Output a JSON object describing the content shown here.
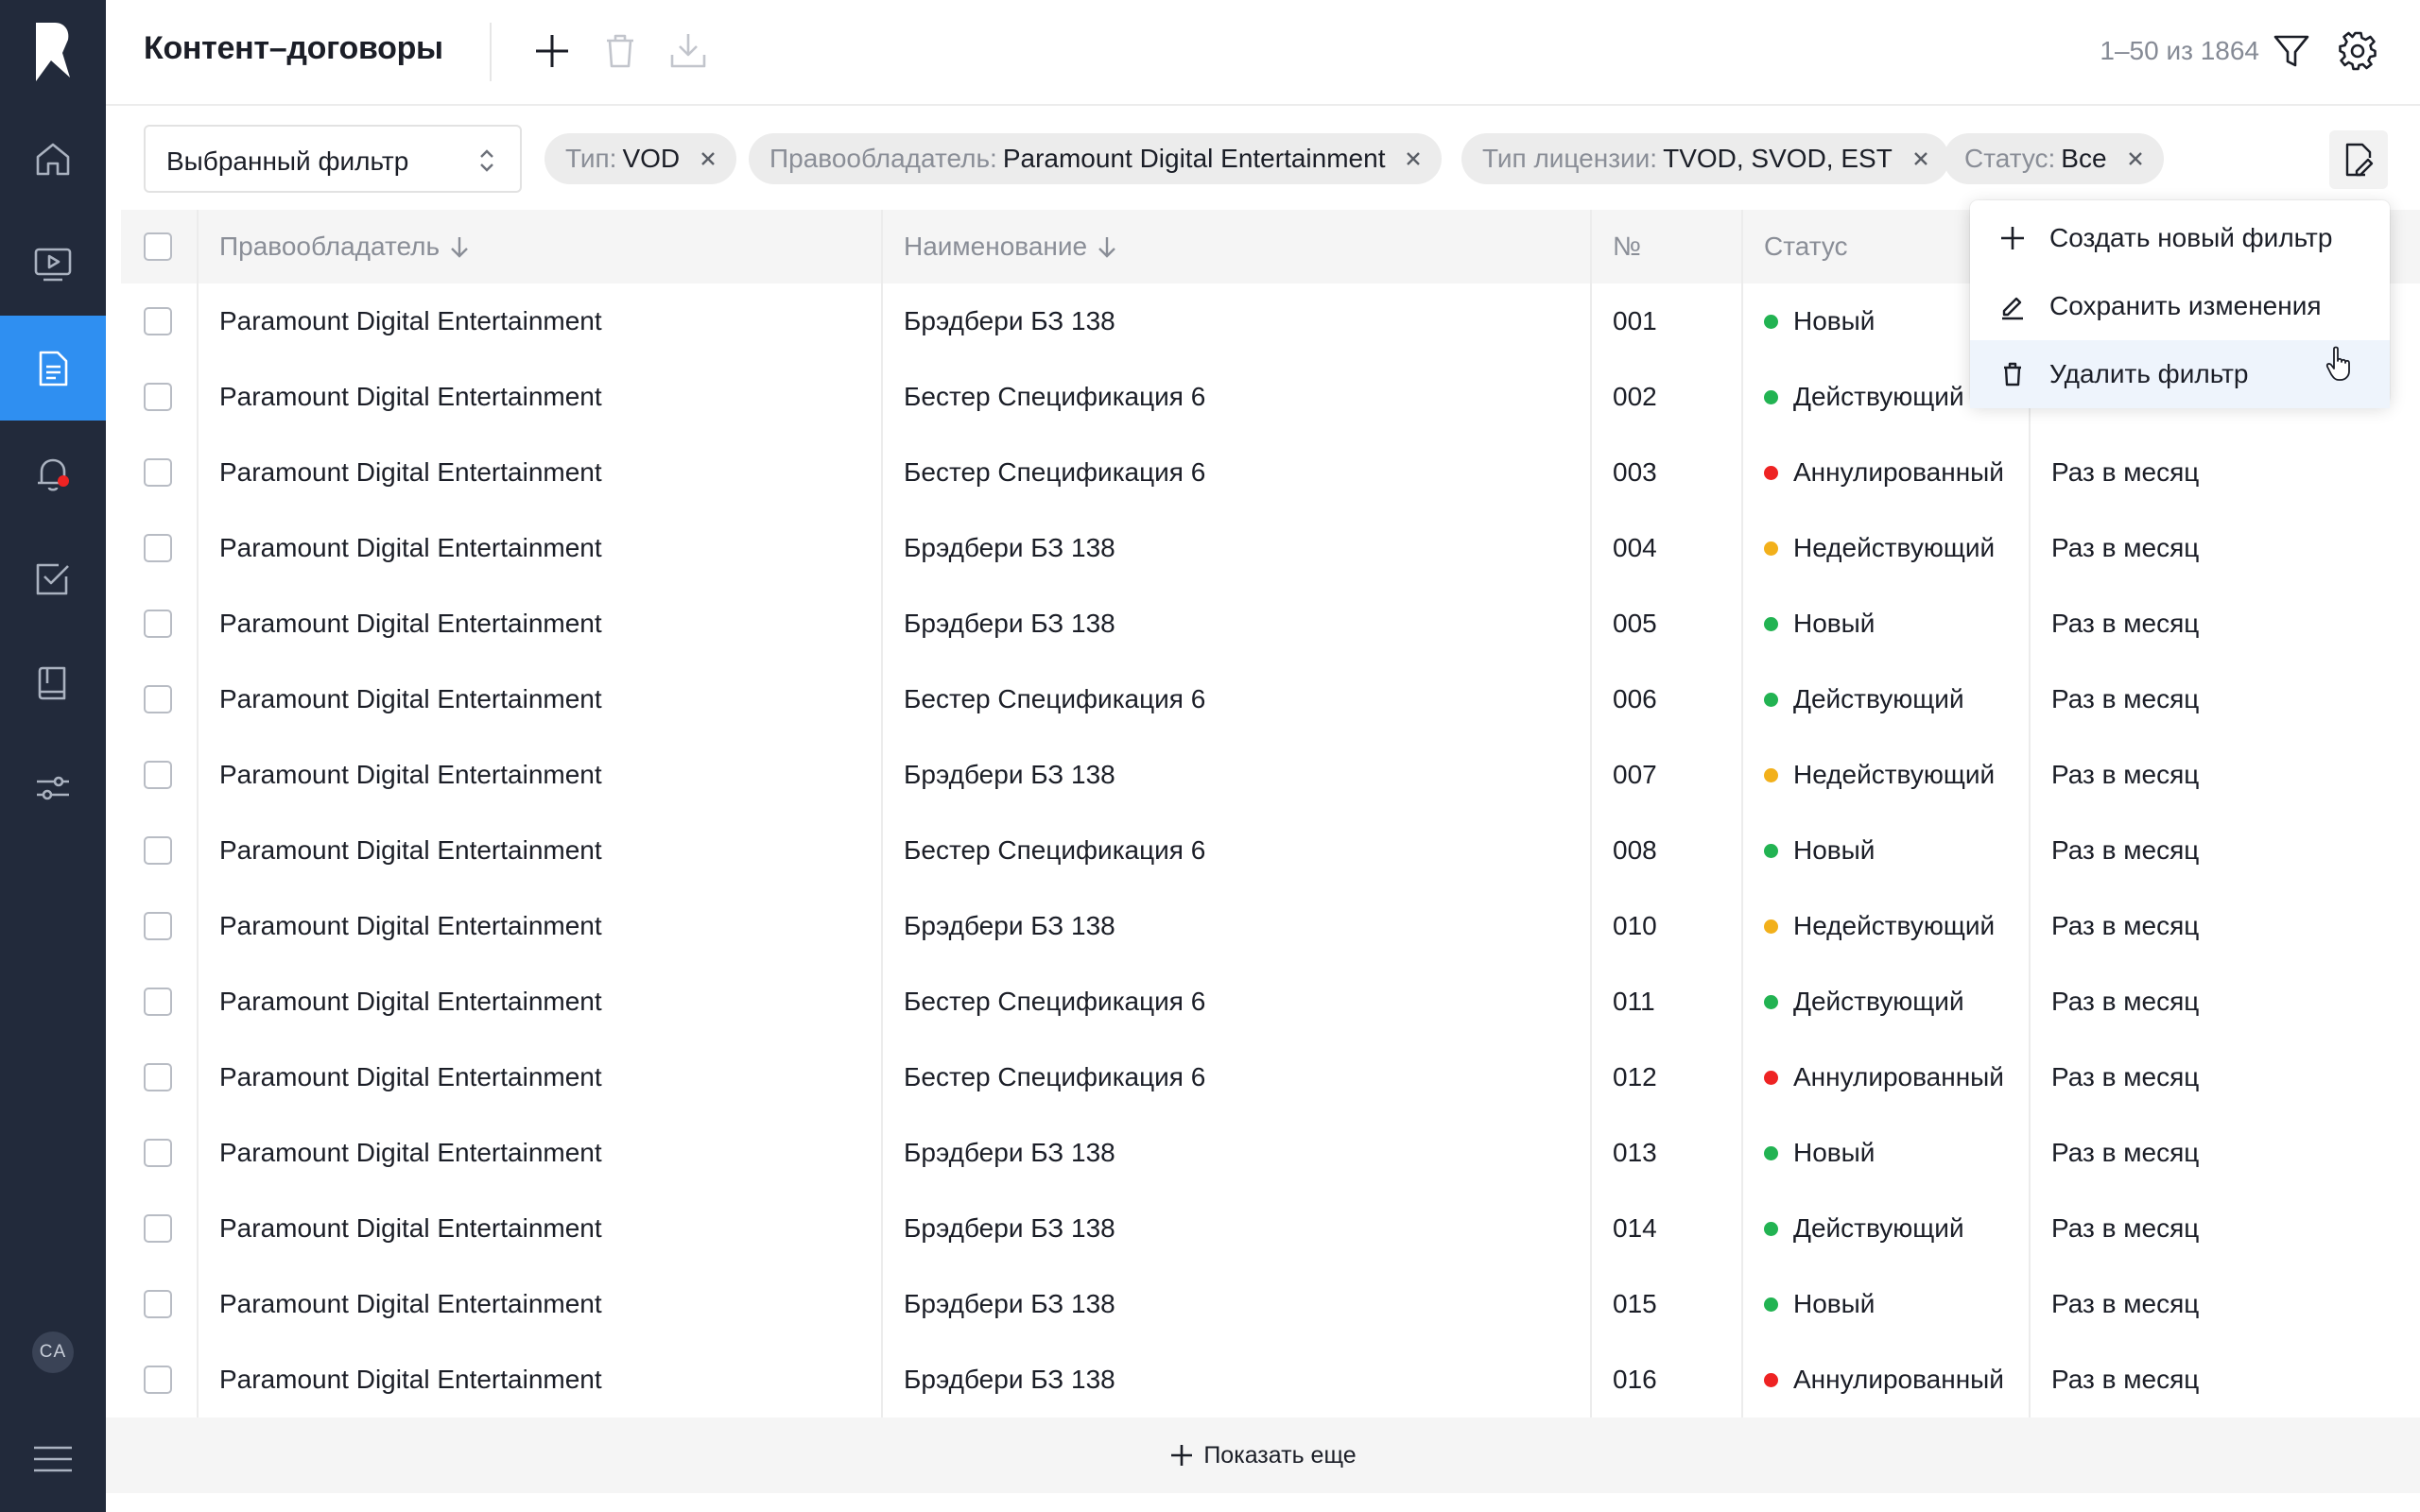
{
  "sidebar": {
    "items": [
      {
        "name": "home-icon",
        "active": false
      },
      {
        "name": "video-icon",
        "active": false
      },
      {
        "name": "document-icon",
        "active": true
      },
      {
        "name": "bell-icon",
        "active": false
      },
      {
        "name": "tasks-icon",
        "active": false
      },
      {
        "name": "book-icon",
        "active": false
      },
      {
        "name": "sliders-icon",
        "active": false
      }
    ],
    "avatar_initials": "CA"
  },
  "header": {
    "title": "Контент–договоры",
    "pagination": "1–50 из 1864"
  },
  "filters": {
    "selected_filter": "Выбранный фильтр",
    "chips": [
      {
        "key": "Тип:",
        "value": "VOD"
      },
      {
        "key": "Правообладатель:",
        "value": "Paramount Digital Entertainment"
      },
      {
        "key": "Тип лицензии:",
        "value": "TVOD, SVOD, EST"
      },
      {
        "key": "Статус:",
        "value": "Все"
      }
    ]
  },
  "dropdown": {
    "items": [
      {
        "label": "Создать новый фильтр",
        "icon": "plus-icon"
      },
      {
        "label": "Сохранить изменения",
        "icon": "pencil-icon"
      },
      {
        "label": "Удалить фильтр",
        "icon": "trash-icon"
      }
    ]
  },
  "table": {
    "columns": {
      "owner": "Правообладатель",
      "name": "Наименование",
      "number": "№",
      "status": "Статус"
    },
    "status_colors": {
      "Новый": "#22b352",
      "Действующий": "#22b352",
      "Аннулированный": "#ee2323",
      "Недействующий": "#f2b01b"
    },
    "rows": [
      {
        "owner": "Paramount Digital Entertainment",
        "name": "Брэдбери БЗ 138",
        "number": "001",
        "status": "Новый",
        "period": ""
      },
      {
        "owner": "Paramount Digital Entertainment",
        "name": "Бестер Спецификация 6",
        "number": "002",
        "status": "Действующий",
        "period": ""
      },
      {
        "owner": "Paramount Digital Entertainment",
        "name": "Бестер Спецификация 6",
        "number": "003",
        "status": "Аннулированный",
        "period": "Раз в месяц"
      },
      {
        "owner": "Paramount Digital Entertainment",
        "name": "Брэдбери БЗ 138",
        "number": "004",
        "status": "Недействующий",
        "period": "Раз в месяц"
      },
      {
        "owner": "Paramount Digital Entertainment",
        "name": "Брэдбери БЗ 138",
        "number": "005",
        "status": "Новый",
        "period": "Раз в месяц"
      },
      {
        "owner": "Paramount Digital Entertainment",
        "name": "Бестер Спецификация 6",
        "number": "006",
        "status": "Действующий",
        "period": "Раз в месяц"
      },
      {
        "owner": "Paramount Digital Entertainment",
        "name": "Брэдбери БЗ 138",
        "number": "007",
        "status": "Недействующий",
        "period": "Раз в месяц"
      },
      {
        "owner": "Paramount Digital Entertainment",
        "name": "Бестер Спецификация 6",
        "number": "008",
        "status": "Новый",
        "period": "Раз в месяц"
      },
      {
        "owner": "Paramount Digital Entertainment",
        "name": "Брэдбери БЗ 138",
        "number": "010",
        "status": "Недействующий",
        "period": "Раз в месяц"
      },
      {
        "owner": "Paramount Digital Entertainment",
        "name": "Бестер Спецификация 6",
        "number": "011",
        "status": "Действующий",
        "period": "Раз в месяц"
      },
      {
        "owner": "Paramount Digital Entertainment",
        "name": "Бестер Спецификация 6",
        "number": "012",
        "status": "Аннулированный",
        "period": "Раз в месяц"
      },
      {
        "owner": "Paramount Digital Entertainment",
        "name": "Брэдбери БЗ 138",
        "number": "013",
        "status": "Новый",
        "period": "Раз в месяц"
      },
      {
        "owner": "Paramount Digital Entertainment",
        "name": "Брэдбери БЗ 138",
        "number": "014",
        "status": "Действующий",
        "period": "Раз в месяц"
      },
      {
        "owner": "Paramount Digital Entertainment",
        "name": "Брэдбери БЗ 138",
        "number": "015",
        "status": "Новый",
        "period": "Раз в месяц"
      },
      {
        "owner": "Paramount Digital Entertainment",
        "name": "Брэдбери БЗ 138",
        "number": "016",
        "status": "Аннулированный",
        "period": "Раз в месяц"
      }
    ]
  },
  "show_more_label": "Показать еще"
}
